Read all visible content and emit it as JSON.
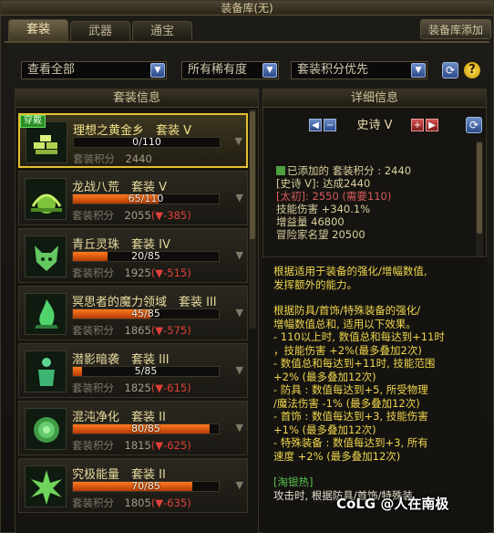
{
  "window": {
    "title": "装备库(无)"
  },
  "tabs": [
    {
      "label": "套装",
      "active": true
    },
    {
      "label": "武器",
      "active": false
    },
    {
      "label": "通宝",
      "active": false
    }
  ],
  "storage_add_label": "装备库添加",
  "filters": {
    "scope": "查看全部",
    "rarity": "所有稀有度",
    "sort": "套装积分优先"
  },
  "list": {
    "header": "套装信息",
    "score_label": "套装积分",
    "items": [
      {
        "name": "理想之黄金乡",
        "tier": "套装 V",
        "progress": "0/110",
        "fill": 0,
        "score": "2440",
        "diff": "",
        "badge": "穿戴",
        "icon": "gold-bars-icon",
        "selected": true
      },
      {
        "name": "龙战八荒",
        "tier": "套装 V",
        "progress": "65/110",
        "fill": 0.59,
        "score": "2055",
        "diff": "(▼-385)",
        "icon": "sun-emblem-icon"
      },
      {
        "name": "青丘灵珠",
        "tier": "套装 IV",
        "progress": "20/85",
        "fill": 0.24,
        "score": "1925",
        "diff": "(▼-515)",
        "icon": "fox-head-icon"
      },
      {
        "name": "冥思者的魔力领域",
        "tier": "套装 III",
        "progress": "45/85",
        "fill": 0.53,
        "score": "1865",
        "diff": "(▼-575)",
        "icon": "green-flame-icon"
      },
      {
        "name": "潜影暗袭",
        "tier": "套装 III",
        "progress": "5/85",
        "fill": 0.06,
        "score": "1825",
        "diff": "(▼-615)",
        "icon": "shadow-figure-icon"
      },
      {
        "name": "混沌净化",
        "tier": "套装 II",
        "progress": "80/85",
        "fill": 0.94,
        "score": "1815",
        "diff": "(▼-625)",
        "icon": "spiral-rose-icon"
      },
      {
        "name": "究极能量",
        "tier": "套装 II",
        "progress": "70/85",
        "fill": 0.82,
        "score": "1805",
        "diff": "(▼-635)",
        "icon": "energy-burst-icon"
      }
    ]
  },
  "detail": {
    "header": "详细信息",
    "grade": "史诗 V",
    "added_line": "已添加的 套装积分 : 2440",
    "epic_line": "[史诗 V]: 达成2440",
    "taichu_line": "[太初]: 2550 (需要110)",
    "skill_line": "技能伤害 +340.1%",
    "boost_line": "增益量 46800",
    "fame_line": "冒险家名望 20500",
    "description": [
      "根据适用于装备的强化/增幅数值,",
      "发挥额外的能力。",
      "",
      "根据防具/首饰/特殊装备的强化/",
      "增幅数值总和, 适用以下效果。",
      "- 110以上时, 数值总和每达到+11时",
      "，技能伤害 +2%(最多叠加2次)",
      "- 数值总和每达到+11时, 技能范围",
      "+2% (最多叠加12次)",
      "- 防具 : 数值每达到+5, 所受物理",
      "/魔法伤害 -1% (最多叠加12次)",
      "- 首饰 : 数值每达到+3, 技能伤害",
      "+1% (最多叠加12次)",
      "- 特殊装备 : 数值每达到+3, 所有",
      "速度 +2% (最多叠加12次)",
      ""
    ],
    "taobaore": "[淘银热]",
    "last_line": "攻击时, 根据防具/首饰/特殊装"
  },
  "watermark": "CoLG @人在南极"
}
